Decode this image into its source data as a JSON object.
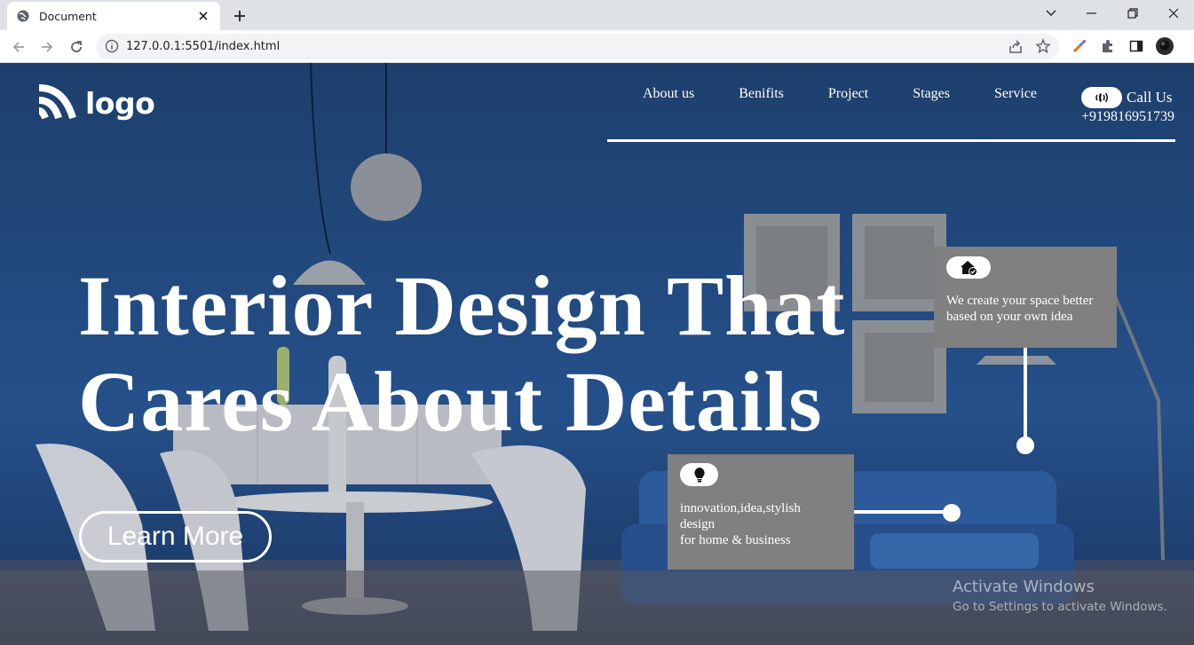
{
  "browser": {
    "tab_title": "Document",
    "url": "127.0.0.1:5501/index.html"
  },
  "site": {
    "logo_text": "logo",
    "nav": [
      "About us",
      "Benifits",
      "Project",
      "Stages",
      "Service"
    ],
    "call": {
      "label": "Call Us",
      "number": "+919816951739"
    },
    "hero": {
      "line1": "Interior Design That",
      "line2": "Cares About Details"
    },
    "cta": "Learn More",
    "card_space": {
      "icon": "home-check-icon",
      "text_line1": "We create your space better",
      "text_line2": "based on your own idea"
    },
    "card_idea": {
      "icon": "lightbulb-icon",
      "text_line1": "innovation,idea,stylish",
      "text_line2": "design",
      "text_line3": "for home & business"
    }
  },
  "watermark": {
    "title": "Activate Windows",
    "subtitle": "Go to Settings to activate Windows."
  },
  "colors": {
    "hero_bg": "#1e3f6e",
    "card_bg": "#808080",
    "text": "#ffffff"
  }
}
